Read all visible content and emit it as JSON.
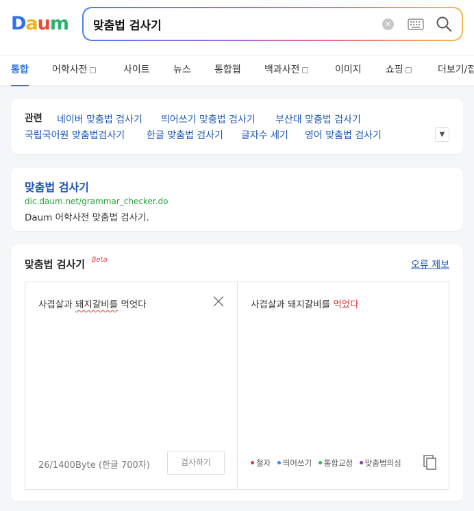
{
  "search": {
    "query": "맞춤법 검사기"
  },
  "logo": {
    "letters": [
      "D",
      "a",
      "u",
      "m"
    ],
    "colors": [
      "#2f6ef5",
      "#f2b21a",
      "#e84a3c",
      "#2bb36b"
    ]
  },
  "tabs": [
    {
      "label": "통합",
      "active": true
    },
    {
      "label": "어학사전",
      "has_box": true
    },
    {
      "label": "사이트"
    },
    {
      "label": "뉴스"
    },
    {
      "label": "통합웹"
    },
    {
      "label": "백과사전",
      "has_box": true
    },
    {
      "label": "이미지"
    },
    {
      "label": "쇼핑",
      "has_box": true
    },
    {
      "label": "더보기/접"
    }
  ],
  "related": {
    "title": "관련",
    "links": [
      "네이버 맞춤법 검사기",
      "띄어쓰기 맞춤법 검사기",
      "부산대 맞춤법 검사기",
      "국립국어원 맞춤법검사기",
      "한글 맞춤법 검사기",
      "글자수 세기",
      "영어 맞춤법 검사기"
    ],
    "toggle_icon": "chevron-down-icon"
  },
  "result": {
    "title": "맞춤법 검사기",
    "url": "dic.daum.net/grammar_checker.do",
    "description": "Daum 어학사전 맞춤법 검사기."
  },
  "checker": {
    "title": "맞춤법 검사기",
    "beta": "βeta",
    "report_link": "오류 제보",
    "input_prefix": "사겹살과 ",
    "input_error": "돼지갈비를",
    "input_suffix": " 먹엇다",
    "byte_count": "26/1400Byte (한글 700자)",
    "check_button": "검사하기",
    "output_prefix": "사겹살과 돼지갈비를 ",
    "output_error": "먹었다",
    "legend": [
      {
        "label": "철자",
        "color": "#e03a3a"
      },
      {
        "label": "띄어쓰기",
        "color": "#3a8fe0"
      },
      {
        "label": "통합교정",
        "color": "#2fb05a"
      },
      {
        "label": "맞춤법의심",
        "color": "#8a35b5"
      }
    ]
  }
}
